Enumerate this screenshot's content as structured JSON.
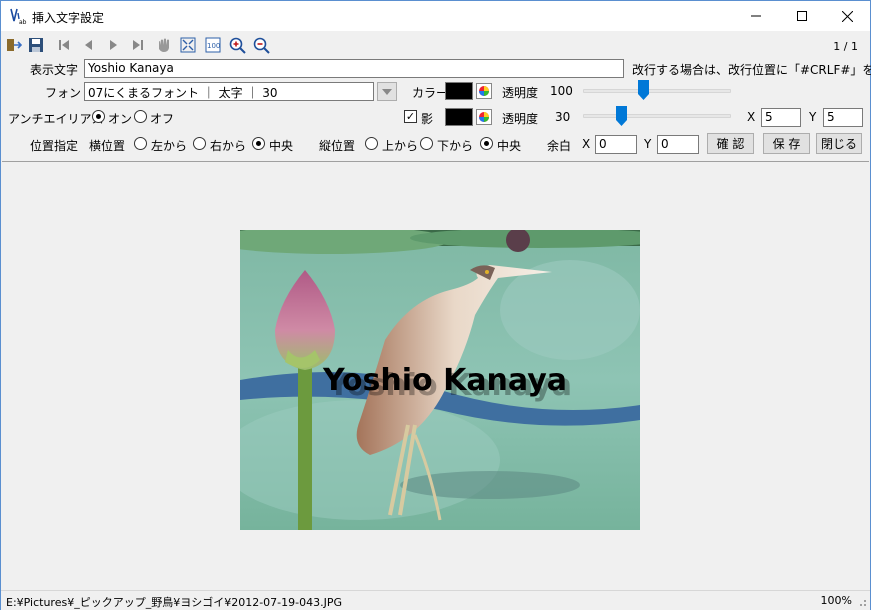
{
  "window": {
    "title": "挿入文字設定",
    "page_counter": "1 / 1"
  },
  "toolbar_icons": [
    "exit-icon",
    "save-icon",
    "first-page-icon",
    "prev-page-icon",
    "next-page-icon",
    "last-page-icon",
    "hand-icon",
    "fit-window-icon",
    "actual-size-icon",
    "zoom-in-icon",
    "zoom-out-icon"
  ],
  "display_text": {
    "label": "表示文字",
    "value": "Yoshio Kanaya",
    "hint": "改行する場合は、改行位置に「#CRLF#」を入力"
  },
  "font": {
    "label": "フォント",
    "value": "07にくまるフォント ｜ 太字 ｜ 30",
    "color_label": "カラー",
    "opacity_label": "透明度",
    "opacity_value": "100",
    "opacity_level": 1.0,
    "color": "#000000"
  },
  "antialias": {
    "label": "アンチエイリアス",
    "on_label": "オン",
    "off_label": "オフ",
    "selected": "on"
  },
  "shadow": {
    "label": "影",
    "checked": true,
    "opacity_label": "透明度",
    "opacity_value": "30",
    "opacity_level": 0.3,
    "x_label": "X",
    "x_value": "5",
    "y_label": "Y",
    "y_value": "5",
    "color": "#000000"
  },
  "position": {
    "label": "位置指定",
    "horizontal_label": "横位置",
    "h_left": "左から",
    "h_right": "右から",
    "h_center": "中央",
    "h_selected": "center",
    "vertical_label": "縦位置",
    "v_top": "上から",
    "v_bottom": "下から",
    "v_center": "中央",
    "v_selected": "center",
    "margin_label": "余白",
    "margin_x_label": "X",
    "margin_x_value": "0",
    "margin_y_label": "Y",
    "margin_y_value": "0"
  },
  "buttons": {
    "confirm": "確 認",
    "save": "保 存",
    "close": "閉じる"
  },
  "preview": {
    "watermark_text": "Yoshio Kanaya"
  },
  "status": {
    "path": "E:¥Pictures¥_ピックアップ_野鳥¥ヨシゴイ¥2012-07-19-043.JPG",
    "zoom": "100%"
  },
  "colors": {
    "accent": "#0078d7",
    "window_bg": "#f0f0f0",
    "border": "#5a8fd0"
  }
}
